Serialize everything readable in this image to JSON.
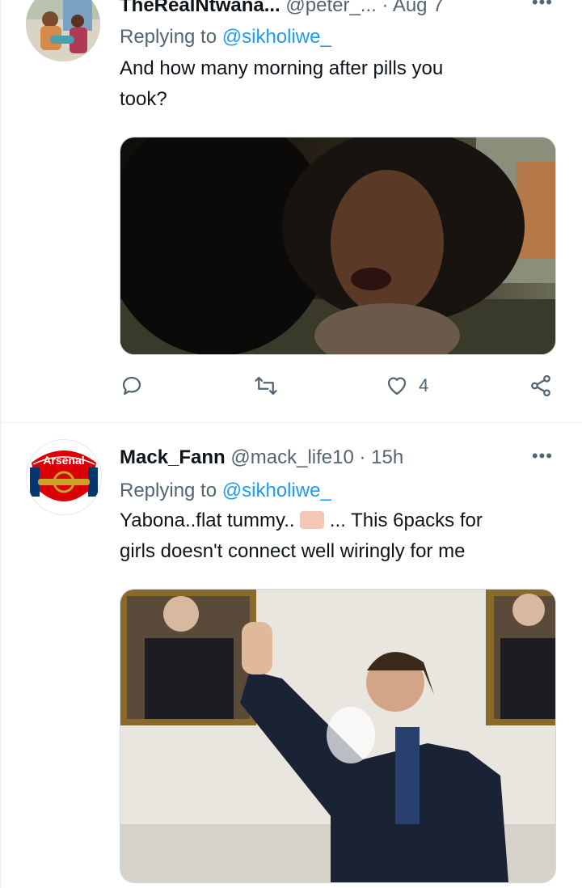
{
  "tweets": [
    {
      "name": "TheRealNtwana...",
      "handle": "@peter_...",
      "separator": "·",
      "time": "Aug 7",
      "replying_prefix": "Replying to",
      "replying_to": "@sikholiwe_",
      "text_line1": "And how many morning after pills you",
      "text_line2": "took?",
      "actions": {
        "reply_icon": "reply-icon",
        "retweet_icon": "retweet-icon",
        "like_icon": "heart-icon",
        "like_count": "4",
        "share_icon": "share-icon"
      }
    },
    {
      "name": "Mack_Fann",
      "handle": "@mack_life10",
      "separator": "·",
      "time": "15h",
      "replying_prefix": "Replying to",
      "replying_to": "@sikholiwe_",
      "text_line1_a": "Yabona..flat tummy..",
      "text_line1_b": "... This 6packs for",
      "text_line2": "girls doesn't connect well  wiringly for me",
      "avatar_logo_text": "Arsenal"
    }
  ],
  "more_glyph": "•••",
  "colors": {
    "link": "#1d9bf0",
    "muted": "#536471",
    "arsenal_red": "#db0007"
  }
}
